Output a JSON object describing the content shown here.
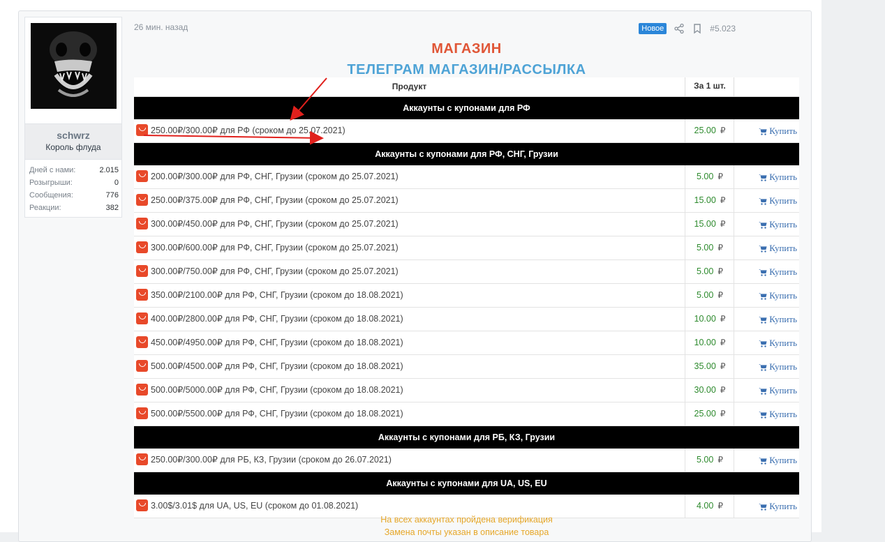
{
  "post": {
    "timestamp": "26 мин. назад",
    "badge_new": "Новое",
    "post_number": "#5.023"
  },
  "user": {
    "name": "schwrz",
    "title": "Король флуда",
    "stats": [
      {
        "label": "Дней с нами:",
        "value": "2.015"
      },
      {
        "label": "Розыгрыши:",
        "value": "0"
      },
      {
        "label": "Сообщения:",
        "value": "776"
      },
      {
        "label": "Реакции:",
        "value": "382"
      }
    ]
  },
  "content": {
    "title": "МАГАЗИН",
    "subtitle": "ТЕЛЕГРАМ МАГАЗИН/РАССЫЛКА",
    "footer_line1": "На всех аккаунтах пройдена верификация",
    "footer_line2": "Замена почты указан в описание товара"
  },
  "table": {
    "col_product": "Продукт",
    "col_price": "За 1 шт.",
    "currency": "₽",
    "buy_label": "Купить",
    "sections": [
      {
        "title": "Аккаунты с купонами для РФ",
        "rows": [
          {
            "product": "250.00₽/300.00₽ для РФ (сроком до 25.07.2021)",
            "price": "25.00"
          }
        ]
      },
      {
        "title": "Аккаунты с купонами для РФ, СНГ, Грузии",
        "rows": [
          {
            "product": "200.00₽/300.00₽ для РФ, СНГ, Грузии (сроком до 25.07.2021)",
            "price": "5.00"
          },
          {
            "product": "250.00₽/375.00₽ для РФ, СНГ, Грузии (сроком до 25.07.2021)",
            "price": "15.00"
          },
          {
            "product": "300.00₽/450.00₽ для РФ, СНГ, Грузии (сроком до 25.07.2021)",
            "price": "15.00"
          },
          {
            "product": "300.00₽/600.00₽ для РФ, СНГ, Грузии (сроком до 25.07.2021)",
            "price": "5.00"
          },
          {
            "product": "300.00₽/750.00₽ для РФ, СНГ, Грузии (сроком до 25.07.2021)",
            "price": "5.00"
          },
          {
            "product": "350.00₽/2100.00₽ для РФ, СНГ, Грузии (сроком до 18.08.2021)",
            "price": "5.00"
          },
          {
            "product": "400.00₽/2800.00₽ для РФ, СНГ, Грузии (сроком до 18.08.2021)",
            "price": "10.00"
          },
          {
            "product": "450.00₽/4950.00₽ для РФ, СНГ, Грузии (сроком до 18.08.2021)",
            "price": "10.00"
          },
          {
            "product": "500.00₽/4500.00₽ для РФ, СНГ, Грузии (сроком до 18.08.2021)",
            "price": "35.00"
          },
          {
            "product": "500.00₽/5000.00₽ для РФ, СНГ, Грузии (сроком до 18.08.2021)",
            "price": "30.00"
          },
          {
            "product": "500.00₽/5500.00₽ для РФ, СНГ, Грузии (сроком до 18.08.2021)",
            "price": "25.00"
          }
        ]
      },
      {
        "title": "Аккаунты с купонами для РБ, КЗ, Грузии",
        "rows": [
          {
            "product": "250.00₽/300.00₽ для РБ, КЗ, Грузии (сроком до 26.07.2021)",
            "price": "5.00"
          }
        ]
      },
      {
        "title": "Аккаунты с купонами для UA, US, EU",
        "rows": [
          {
            "product": "3.00$/3.01$ для UA, US, EU (сроком до 01.08.2021)",
            "price": "4.00"
          }
        ]
      }
    ]
  },
  "colors": {
    "title": "#e05637",
    "subtitle": "#4ea3d6",
    "price": "#2d8a2d",
    "buy_link": "#3b6fb0",
    "badge": "#2b86d9",
    "note": "#e6a72a",
    "annotation_arrow": "#e0201c"
  },
  "icons": {
    "product": "aliexpress-icon",
    "buy": "cart-icon",
    "share": "share-icon",
    "bookmark": "bookmark-icon"
  }
}
